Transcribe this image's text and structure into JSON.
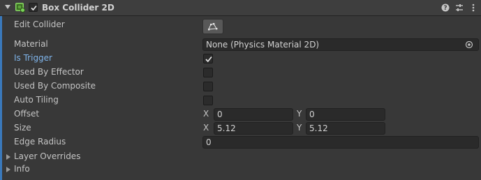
{
  "component": {
    "title": "Box Collider 2D",
    "enabled": true
  },
  "edit_collider": {
    "label": "Edit Collider"
  },
  "material": {
    "label": "Material",
    "value": "None (Physics Material 2D)"
  },
  "is_trigger": {
    "label": "Is Trigger",
    "checked": true
  },
  "used_by_effector": {
    "label": "Used By Effector",
    "checked": false
  },
  "used_by_composite": {
    "label": "Used By Composite",
    "checked": false
  },
  "auto_tiling": {
    "label": "Auto Tiling",
    "checked": false
  },
  "offset": {
    "label": "Offset",
    "x_label": "X",
    "x": "0",
    "y_label": "Y",
    "y": "0"
  },
  "size": {
    "label": "Size",
    "x_label": "X",
    "x": "5.12",
    "y_label": "Y",
    "y": "5.12"
  },
  "edge_radius": {
    "label": "Edge Radius",
    "value": "0"
  },
  "layer_overrides": {
    "label": "Layer Overrides"
  },
  "info": {
    "label": "Info"
  },
  "colors": {
    "accent": "#3a79bb",
    "highlight_label": "#7fb4ea",
    "background": "#383838"
  },
  "icons": [
    "foldout-arrow-icon",
    "box-collider-2d-icon",
    "checkmark-icon",
    "help-icon",
    "presets-icon",
    "kebab-menu-icon",
    "edit-collider-icon",
    "object-picker-icon"
  ]
}
